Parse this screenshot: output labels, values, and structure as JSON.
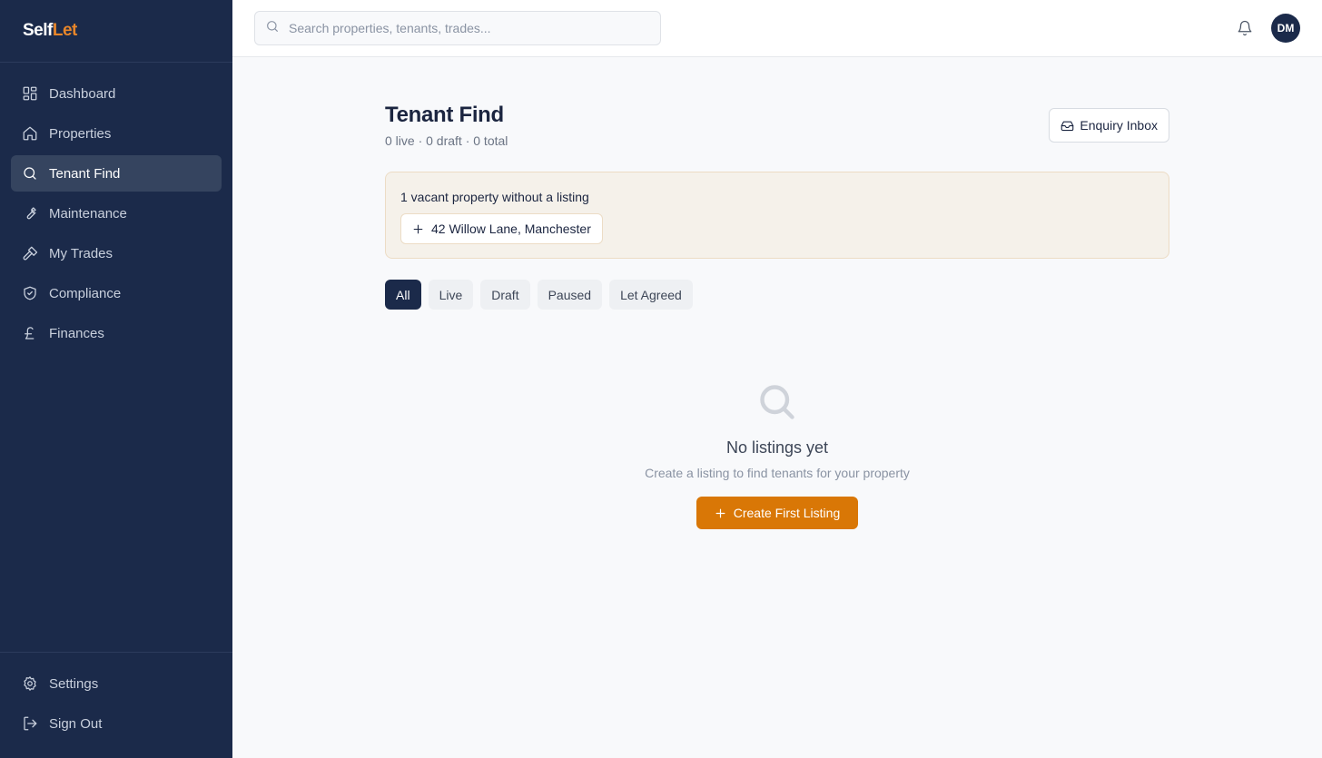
{
  "brand": {
    "part1": "Self",
    "part2": "Let"
  },
  "sidebar": {
    "items": [
      {
        "label": "Dashboard",
        "icon": "dashboard-icon",
        "active": false
      },
      {
        "label": "Properties",
        "icon": "home-icon",
        "active": false
      },
      {
        "label": "Tenant Find",
        "icon": "search-icon",
        "active": true
      },
      {
        "label": "Maintenance",
        "icon": "wrench-icon",
        "active": false
      },
      {
        "label": "My Trades",
        "icon": "hammer-icon",
        "active": false
      },
      {
        "label": "Compliance",
        "icon": "shield-check-icon",
        "active": false
      },
      {
        "label": "Finances",
        "icon": "pound-icon",
        "active": false
      }
    ],
    "bottom": [
      {
        "label": "Settings",
        "icon": "gear-icon"
      },
      {
        "label": "Sign Out",
        "icon": "sign-out-icon"
      }
    ]
  },
  "topbar": {
    "search_placeholder": "Search properties, tenants, trades...",
    "avatar_initials": "DM"
  },
  "page": {
    "title": "Tenant Find",
    "subtitle": "0 live · 0 draft · 0 total",
    "inbox_label": "Enquiry Inbox"
  },
  "vacant": {
    "title": "1 vacant property without a listing",
    "property": "42 Willow Lane, Manchester"
  },
  "filters": [
    {
      "label": "All",
      "active": true
    },
    {
      "label": "Live",
      "active": false
    },
    {
      "label": "Draft",
      "active": false
    },
    {
      "label": "Paused",
      "active": false
    },
    {
      "label": "Let Agreed",
      "active": false
    }
  ],
  "empty": {
    "title": "No listings yet",
    "subtitle": "Create a listing to find tenants for your property",
    "cta": "Create First Listing"
  },
  "colors": {
    "sidebar_bg": "#1b2a4a",
    "accent": "#d97706",
    "brand_accent": "#e8862a"
  }
}
